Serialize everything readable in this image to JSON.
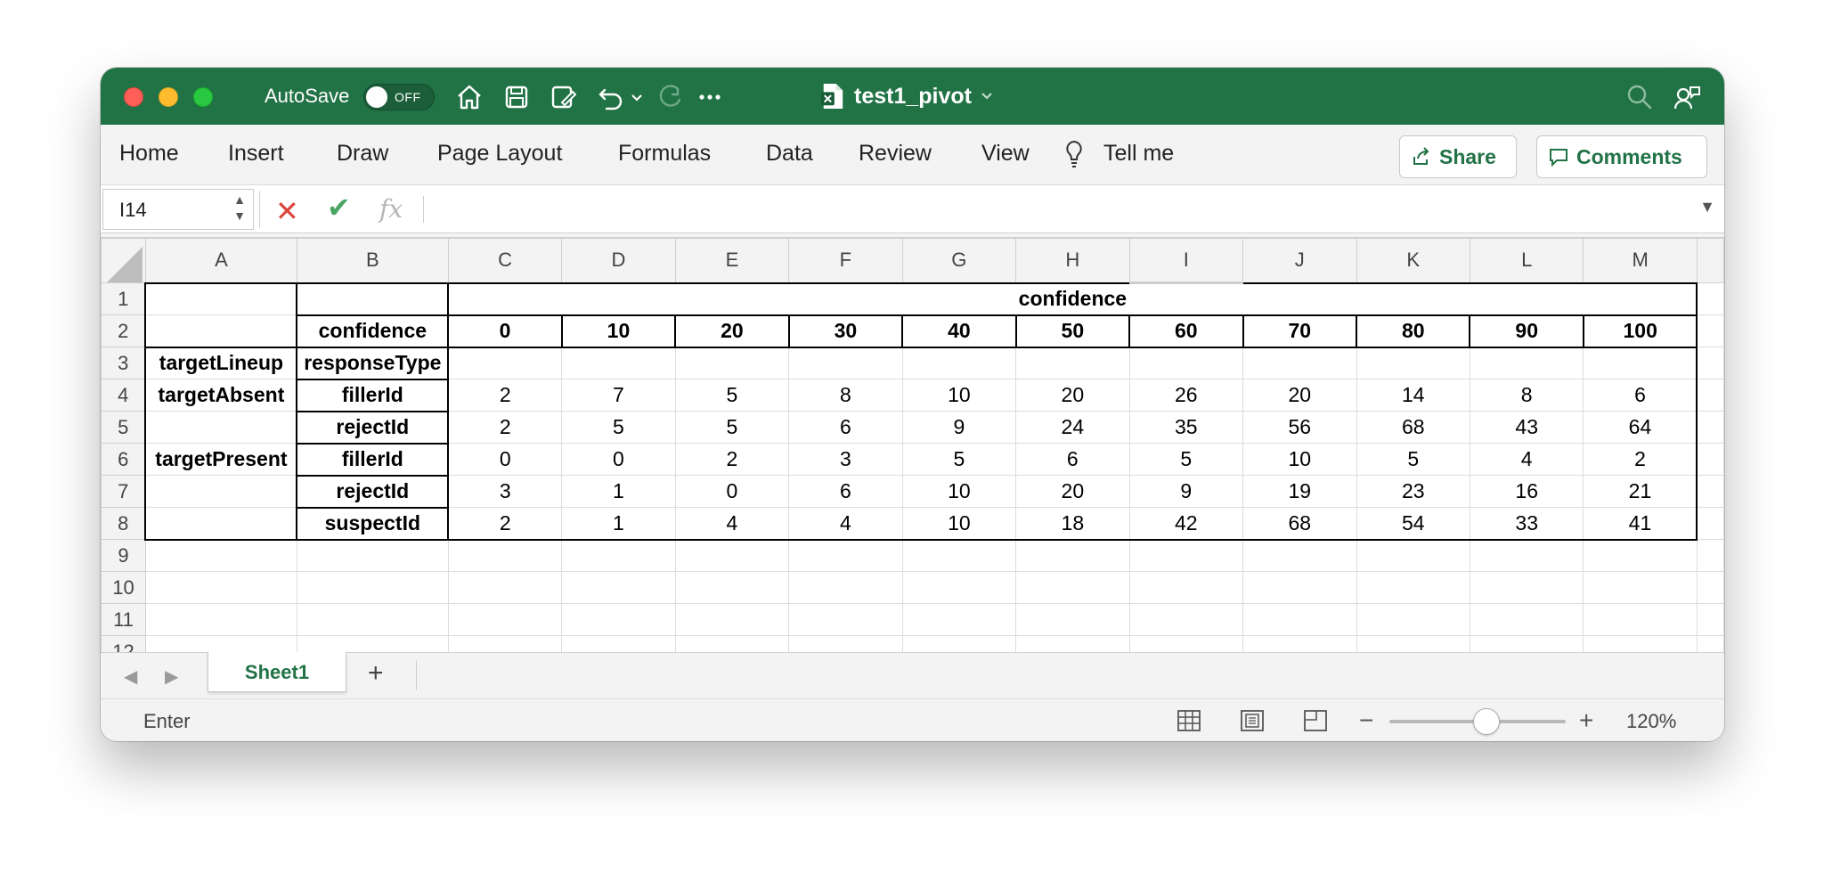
{
  "window": {
    "autosave_label": "AutoSave",
    "autosave_state": "OFF",
    "doc_title": "test1_pivot"
  },
  "ribbon": {
    "tabs": [
      "Home",
      "Insert",
      "Draw",
      "Page Layout",
      "Formulas",
      "Data",
      "Review",
      "View",
      "Tell me"
    ],
    "share_label": "Share",
    "comments_label": "Comments"
  },
  "formula_bar": {
    "name_box": "I14",
    "formula": "",
    "fx_label": "fx"
  },
  "sheet": {
    "columns": [
      "A",
      "B",
      "C",
      "D",
      "E",
      "F",
      "G",
      "H",
      "I",
      "J",
      "K",
      "L",
      "M"
    ],
    "selected_column": "I",
    "rows": [
      [
        "",
        "",
        "confidence"
      ],
      [
        "",
        "confidence",
        "0",
        "10",
        "20",
        "30",
        "40",
        "50",
        "60",
        "70",
        "80",
        "90",
        "100"
      ],
      [
        "targetLineup",
        "responseType",
        "",
        "",
        "",
        "",
        "",
        "",
        "",
        "",
        "",
        "",
        ""
      ],
      [
        "targetAbsent",
        "fillerId",
        "2",
        "7",
        "5",
        "8",
        "10",
        "20",
        "26",
        "20",
        "14",
        "8",
        "6"
      ],
      [
        "",
        "rejectId",
        "2",
        "5",
        "5",
        "6",
        "9",
        "24",
        "35",
        "56",
        "68",
        "43",
        "64"
      ],
      [
        "targetPresent",
        "fillerId",
        "0",
        "0",
        "2",
        "3",
        "5",
        "6",
        "5",
        "10",
        "5",
        "4",
        "2"
      ],
      [
        "",
        "rejectId",
        "3",
        "1",
        "0",
        "6",
        "10",
        "20",
        "9",
        "19",
        "23",
        "16",
        "21"
      ],
      [
        "",
        "suspectId",
        "2",
        "1",
        "4",
        "4",
        "10",
        "18",
        "42",
        "68",
        "54",
        "33",
        "41"
      ],
      [
        "",
        "",
        "",
        "",
        "",
        "",
        "",
        "",
        "",
        "",
        "",
        "",
        ""
      ],
      [
        "",
        "",
        "",
        "",
        "",
        "",
        "",
        "",
        "",
        "",
        "",
        "",
        ""
      ],
      [
        "",
        "",
        "",
        "",
        "",
        "",
        "",
        "",
        "",
        "",
        "",
        "",
        ""
      ],
      [
        "",
        "",
        "",
        "",
        "",
        "",
        "",
        "",
        "",
        "",
        "",
        "",
        ""
      ]
    ],
    "tab_name": "Sheet1"
  },
  "status_bar": {
    "mode": "Enter",
    "zoom": "120%",
    "zoom_fraction": 0.55
  },
  "colors": {
    "excel_green": "#217346",
    "ribbon_bg": "#f3f3f3"
  }
}
